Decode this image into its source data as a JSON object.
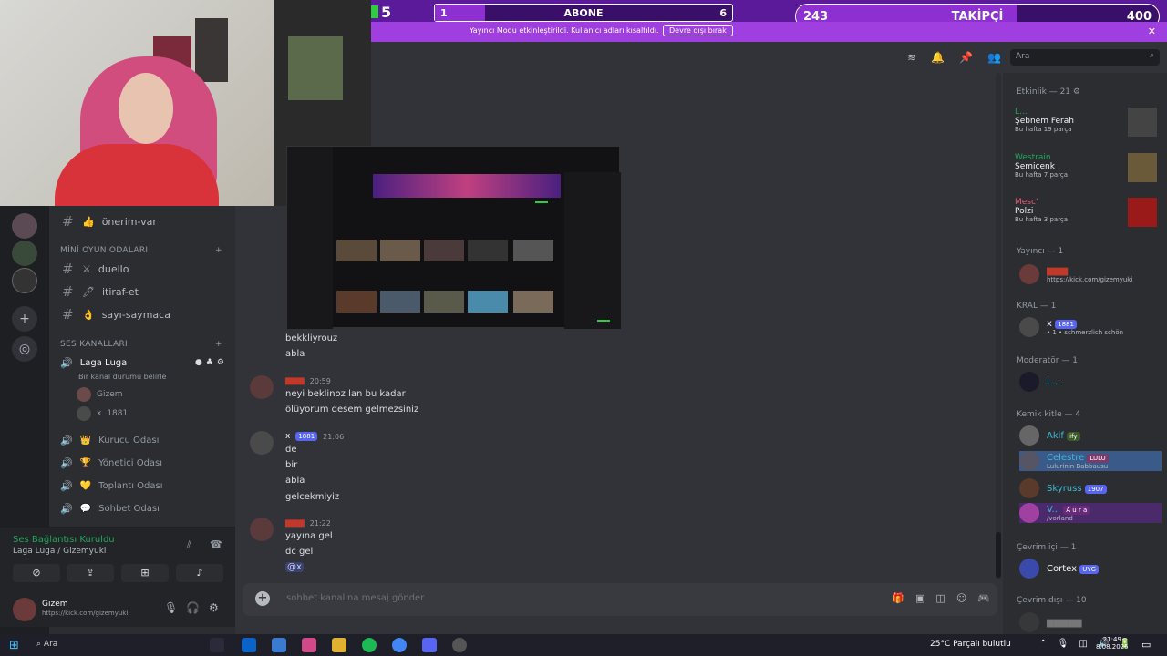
{
  "stream": {
    "sub_goal_current": "1",
    "sub_goal_label": "ABONE",
    "sub_goal_target": "6",
    "sub_goal_progress": 0.17,
    "level_badge": "5",
    "follow_current": "243",
    "follow_label": "TAKİPÇİ",
    "follow_target": "400",
    "follow_progress": 0.61,
    "mode_banner": "Yayıncı Modu etkinleştirildi. Kullanıcı adları kısaltıldı.",
    "mode_disable_button": "Devre dışı bırak",
    "accent_color": "#9f3fe0"
  },
  "sidebar": {
    "channels_top": [
      {
        "emoji": "👍",
        "name": "önerim-var"
      }
    ],
    "cat_mini_games": "MİNİ OYUN ODALARI",
    "mini_game_channels": [
      {
        "emoji": "⚔",
        "name": "duello"
      },
      {
        "emoji": "🖊",
        "name": "itiraf-et"
      },
      {
        "emoji": "👌",
        "name": "sayı-saymaca"
      }
    ],
    "cat_voice": "SES KANALLARI",
    "active_voice": {
      "name": "Laga Luga",
      "status_prompt": "Bir kanal durumu belirle",
      "members": [
        {
          "name": "Gizem"
        },
        {
          "name": "x",
          "badge": "1881"
        }
      ]
    },
    "voice_channels": [
      {
        "emoji": "👑",
        "name": "Kurucu Odası"
      },
      {
        "emoji": "🏆",
        "name": "Yönetici Odası"
      },
      {
        "emoji": "💛",
        "name": "Toplantı Odası"
      },
      {
        "emoji": "💬",
        "name": "Sohbet Odası"
      }
    ]
  },
  "voice_panel": {
    "status": "Ses Bağlantısı Kuruldu",
    "location": "Laga Luga / Gizemyuki"
  },
  "user_panel": {
    "name": "Gizem",
    "status": "https://kick.com/gizemyuki"
  },
  "chat": {
    "search_placeholder": "Ara",
    "messages_pre": [
      "bekkliyrouz",
      "abla"
    ],
    "msg1": {
      "time": "20:59",
      "lines": [
        "neyi beklinoz lan bu kadar",
        "ölüyorum desem gelmezsiniz"
      ]
    },
    "msg2": {
      "name": "x",
      "badge": "1881",
      "time": "21:06",
      "lines": [
        "de",
        "bir",
        "abla",
        "gelcekmiyiz"
      ]
    },
    "msg3": {
      "time": "21:22",
      "lines": [
        "yayına gel",
        "dc gel"
      ],
      "mention": "@x"
    },
    "composer_placeholder": "sohbet kanalına mesaj gönder"
  },
  "members": {
    "activity_header": "Etkinlik — 21",
    "activities": [
      {
        "user": "L...",
        "artist": "Şebnem Ferah",
        "meta": "Bu hafta 19 parça"
      },
      {
        "user": "Westrain",
        "artist": "Semicenk",
        "meta": "Bu hafta 7 parça"
      },
      {
        "user": "Mesc'",
        "artist": "Polzi",
        "meta": "Bu hafta 3 parça"
      }
    ],
    "streamer_header": "Yayıncı — 1",
    "streamer": {
      "status": "https://kick.com/gizemyuki"
    },
    "kral_header": "KRAL — 1",
    "kral": {
      "name": "x",
      "badge": "1881",
      "sub": "• 1 • schmerzlich schön"
    },
    "mod_header": "Moderatör — 1",
    "mod": {
      "name": "L..."
    },
    "kemik_header": "Kemik kitle — 4",
    "kemik": [
      {
        "name": "Akif",
        "tag": "ify"
      },
      {
        "name": "Celestre",
        "tag": "LULU",
        "sub": "Lulurinin Babbausu"
      },
      {
        "name": "Skyruss",
        "tag": "1907"
      },
      {
        "name": "V...",
        "tag": "A u r a",
        "sub": "/vorland"
      }
    ],
    "online_header": "Çevrim içi — 1",
    "online": {
      "name": "Cortex",
      "tag": "UYG"
    },
    "offline_header": "Çevrim dışı — 10"
  },
  "taskbar": {
    "search": "Ara",
    "weather": "25°C  Parçalı bulutlu",
    "time": "21:49",
    "date": "8.08.2025"
  }
}
